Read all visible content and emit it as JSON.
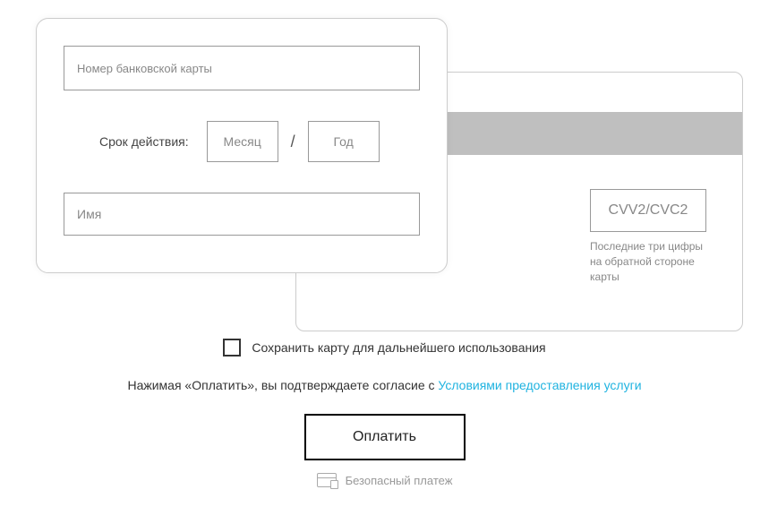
{
  "front": {
    "card_number_placeholder": "Номер банковской карты",
    "expiry_label": "Срок действия:",
    "month_placeholder": "Месяц",
    "year_placeholder": "Год",
    "name_placeholder": "Имя"
  },
  "back": {
    "cvv_placeholder": "CVV2/CVC2",
    "cvv_hint": "Последние три цифры на обратной стороне карты"
  },
  "save": {
    "label": "Сохранить карту для дальнейшего использования"
  },
  "agree": {
    "prefix": "Нажимая «Оплатить», вы подтверждаете согласие с ",
    "link": "Условиями предоставления услуги"
  },
  "pay_label": "Оплатить",
  "secure_label": "Безопасный платеж"
}
